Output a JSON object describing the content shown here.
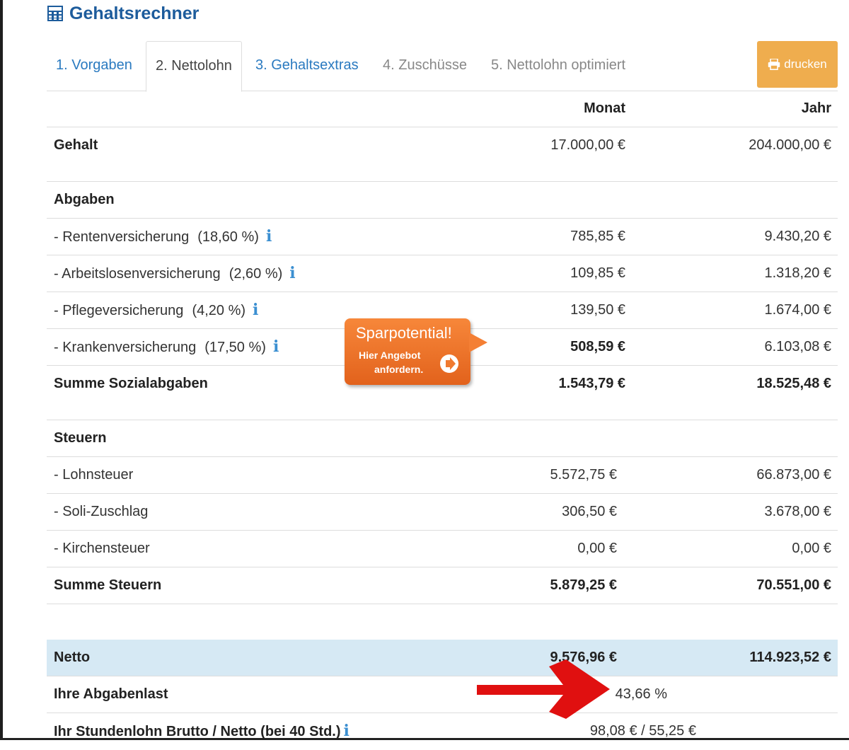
{
  "app": {
    "title": "Gehaltsrechner"
  },
  "tabs": [
    {
      "label": "1. Vorgaben",
      "state": "link"
    },
    {
      "label": "2. Nettolohn",
      "state": "active"
    },
    {
      "label": "3. Gehaltsextras",
      "state": "link"
    },
    {
      "label": "4. Zuschüsse",
      "state": "disabled"
    },
    {
      "label": "5. Nettolohn optimiert",
      "state": "disabled"
    }
  ],
  "print_button": {
    "label": "drucken",
    "icon": "printer-icon",
    "color": "#efad4e"
  },
  "columns": {
    "month": "Monat",
    "year": "Jahr"
  },
  "gehalt": {
    "label": "Gehalt",
    "month": "17.000,00 €",
    "year": "204.000,00 €"
  },
  "abgaben": {
    "heading": "Abgaben",
    "items": [
      {
        "label": "- Rentenversicherung",
        "rate": "(18,60 %)",
        "month": "785,85 €",
        "year": "9.430,20 €"
      },
      {
        "label": "- Arbeitslosenversicherung",
        "rate": "(2,60 %)",
        "month": "109,85 €",
        "year": "1.318,20 €"
      },
      {
        "label": "- Pflegeversicherung",
        "rate": "(4,20 %)",
        "month": "139,50 €",
        "year": "1.674,00 €"
      },
      {
        "label": "- Krankenversicherung",
        "rate": "(17,50 %)",
        "month": "508,59 €",
        "year": "6.103,08 €"
      }
    ],
    "sum": {
      "label": "Summe Sozialabgaben",
      "month": "1.543,79 €",
      "year": "18.525,48 €"
    }
  },
  "steuern": {
    "heading": "Steuern",
    "items": [
      {
        "label": "- Lohnsteuer",
        "month": "5.572,75 €",
        "year": "66.873,00 €"
      },
      {
        "label": "- Soli-Zuschlag",
        "month": "306,50 €",
        "year": "3.678,00 €"
      },
      {
        "label": "- Kirchensteuer",
        "month": "0,00 €",
        "year": "0,00 €"
      }
    ],
    "sum": {
      "label": "Summe Steuern",
      "month": "5.879,25 €",
      "year": "70.551,00 €"
    }
  },
  "netto": {
    "label": "Netto",
    "month": "9.576,96 €",
    "year": "114.923,52 €"
  },
  "abgabenlast": {
    "label": "Ihre Abgabenlast",
    "value": "43,66 %"
  },
  "stundenlohn": {
    "label": "Ihr Stundenlohn Brutto / Netto (bei 40 Std.)",
    "value": "98,08 € / 55,25 €"
  },
  "promo": {
    "title": "Sparpotential!",
    "line1": "Hier Angebot",
    "line2": "anfordern.",
    "color": "#f07a30"
  },
  "colors": {
    "title": "#1d5c9c",
    "link": "#2a7ac0",
    "info": "#3b8fd1",
    "netto_row": "#d6e9f4",
    "annotation_arrow": "#e01010"
  }
}
